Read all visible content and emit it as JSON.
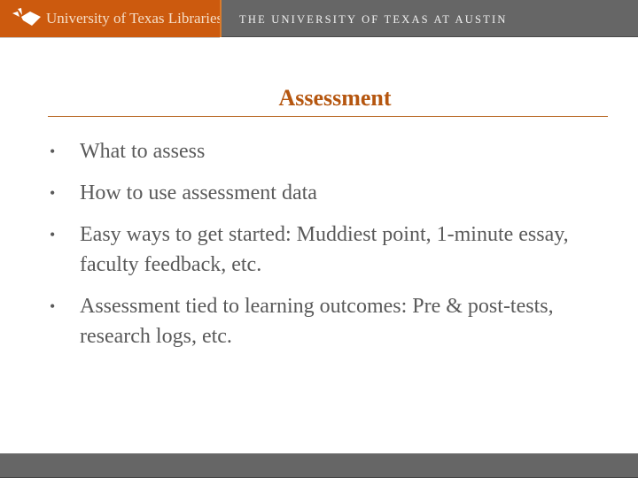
{
  "header": {
    "library_name": "University of Texas Libraries",
    "university_name": "THE UNIVERSITY OF TEXAS AT AUSTIN",
    "logo_icon": "open-book-icon",
    "brand_color": "#cc5a0e",
    "bar_color": "#666666"
  },
  "slide": {
    "title": "Assessment",
    "title_color": "#b5560f",
    "bullets": [
      {
        "text": "What to assess"
      },
      {
        "text": "How to use assessment data"
      },
      {
        "text": "Easy ways to get started:  Muddiest point, 1-minute essay, faculty feedback, etc."
      },
      {
        "text": "Assessment tied to learning outcomes: Pre & post-tests, research logs, etc."
      }
    ],
    "bullet_glyph": "•"
  }
}
